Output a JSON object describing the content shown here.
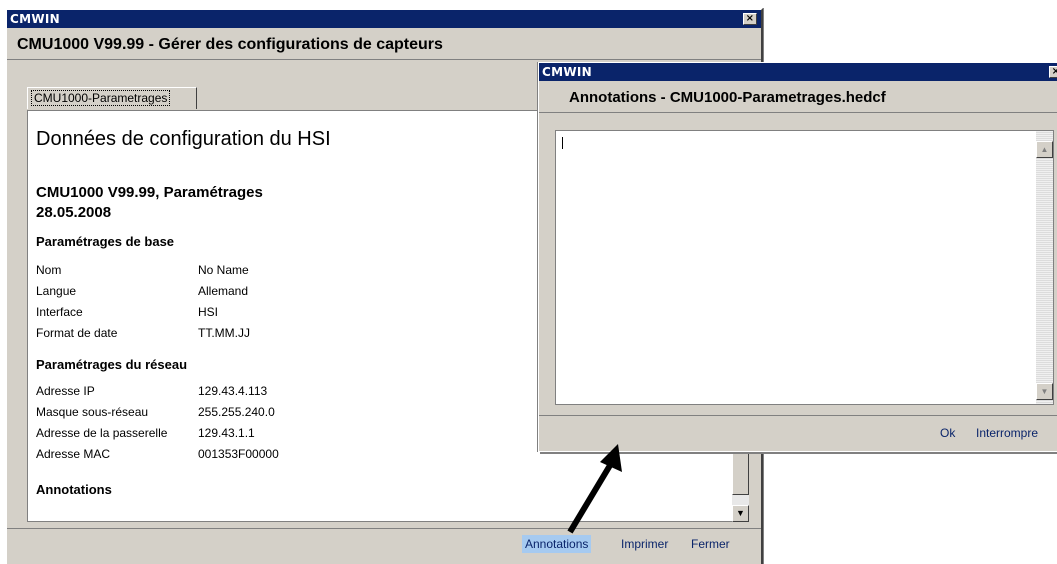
{
  "main_window": {
    "app_title": "CMWIN",
    "close_glyph": "×",
    "subtitle": "CMU1000 V99.99 - Gérer des configurations de capteurs",
    "tab_label": "CMU1000-Parametrages",
    "heading": "Données de configuration du HSI",
    "subheading_line1": "CMU1000 V99.99, Paramétrages",
    "subheading_line2": "28.05.2008",
    "section_base": {
      "title": "Paramétrages de base",
      "rows": [
        {
          "label": "Nom",
          "value": "No Name"
        },
        {
          "label": "Langue",
          "value": "Allemand"
        },
        {
          "label": "Interface",
          "value": "HSI"
        },
        {
          "label": "Format de date",
          "value": "TT.MM.JJ"
        }
      ]
    },
    "section_network": {
      "title": "Paramétrages du réseau",
      "rows": [
        {
          "label": "Adresse IP",
          "value": "129.43.4.113"
        },
        {
          "label": "Masque sous-réseau",
          "value": "255.255.240.0"
        },
        {
          "label": "Adresse de la passerelle",
          "value": "129.43.1.1"
        },
        {
          "label": "Adresse MAC",
          "value": "001353F00000"
        }
      ]
    },
    "section_annotations_title": "Annotations",
    "buttons": {
      "annotations": "Annotations",
      "print": "Imprimer",
      "close": "Fermer"
    }
  },
  "annotation_dialog": {
    "app_title": "CMWIN",
    "close_glyph": "×",
    "subtitle": "Annotations - CMU1000-Parametrages.hedcf",
    "editor_value": "",
    "buttons": {
      "ok": "Ok",
      "cancel": "Interrompre"
    }
  },
  "colors": {
    "titlebar": "#0a246a",
    "window_face": "#d4d0c8",
    "link": "#0a246a",
    "active_button": "#a6caf0"
  },
  "icons": {
    "close": "close-icon",
    "scroll_up": "scroll-up-arrow-icon",
    "scroll_down": "scroll-down-arrow-icon",
    "callout_arrow": "callout-arrow-icon"
  }
}
